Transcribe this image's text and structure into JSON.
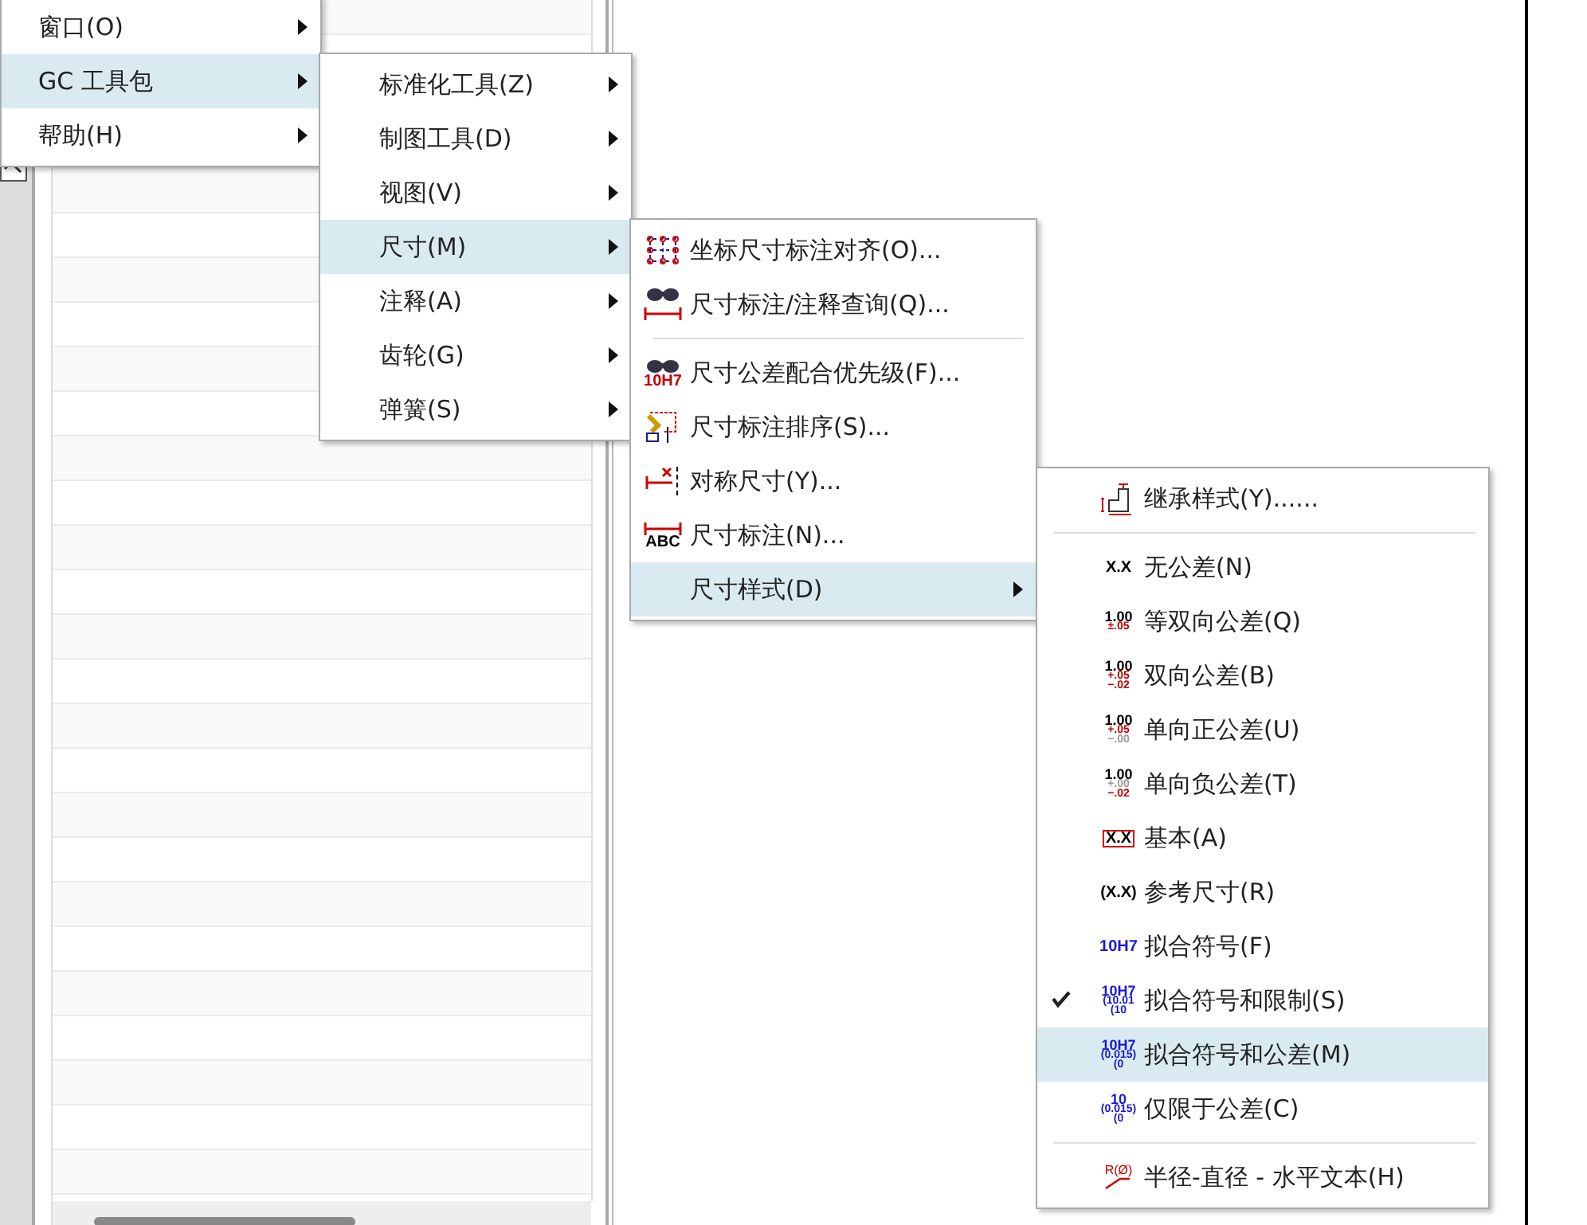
{
  "menus": [
    {
      "items": [
        {
          "kind": "submenu",
          "label": "窗口(O)",
          "selected": false
        },
        {
          "kind": "submenu",
          "label": "GC 工具包",
          "selected": true
        },
        {
          "kind": "submenu",
          "label": "帮助(H)",
          "selected": false
        }
      ]
    },
    {
      "items": [
        {
          "kind": "submenu",
          "label": "标准化工具(Z)",
          "selected": false
        },
        {
          "kind": "submenu",
          "label": "制图工具(D)",
          "selected": false
        },
        {
          "kind": "submenu",
          "label": "视图(V)",
          "selected": false
        },
        {
          "kind": "submenu",
          "label": "尺寸(M)",
          "selected": true
        },
        {
          "kind": "submenu",
          "label": "注释(A)",
          "selected": false
        },
        {
          "kind": "submenu",
          "label": "齿轮(G)",
          "selected": false
        },
        {
          "kind": "submenu",
          "label": "弹簧(S)",
          "selected": false
        }
      ]
    },
    {
      "items": [
        {
          "kind": "command",
          "label": "坐标尺寸标注对齐(O)...",
          "selected": false,
          "icon": {
            "kind": "grid"
          }
        },
        {
          "kind": "command",
          "label": "尺寸标注/注释查询(Q)...",
          "selected": false,
          "icon": {
            "kind": "binocular-dim"
          }
        },
        {
          "kind": "separator"
        },
        {
          "kind": "command",
          "label": "尺寸公差配合优先级(F)...",
          "selected": false,
          "icon": {
            "kind": "binocular-text",
            "lines": [
              {
                "text": "10H7",
                "color": "#c00000"
              }
            ]
          }
        },
        {
          "kind": "command",
          "label": "尺寸标注排序(S)...",
          "selected": false,
          "icon": {
            "kind": "sort"
          }
        },
        {
          "kind": "command",
          "label": "对称尺寸(Y)...",
          "selected": false,
          "icon": {
            "kind": "symmetric"
          }
        },
        {
          "kind": "command",
          "label": "尺寸标注(N)...",
          "selected": false,
          "icon": {
            "kind": "dim-text",
            "lines": [
              {
                "text": "ABC",
                "color": "#000000"
              }
            ]
          }
        },
        {
          "kind": "submenu",
          "label": "尺寸样式(D)",
          "selected": true
        }
      ]
    },
    {
      "items": [
        {
          "kind": "command",
          "label": "继承样式(Y)......",
          "selected": false,
          "checked": false,
          "icon": {
            "kind": "inherit"
          }
        },
        {
          "kind": "separator"
        },
        {
          "kind": "command",
          "label": "无公差(N)",
          "selected": false,
          "checked": false,
          "icon": {
            "kind": "text",
            "lines": [
              {
                "text": "X.X",
                "color": "#000000"
              }
            ]
          }
        },
        {
          "kind": "command",
          "label": "等双向公差(Q)",
          "selected": false,
          "checked": false,
          "icon": {
            "kind": "text",
            "lines": [
              {
                "text": "1.00",
                "color": "#000000"
              },
              {
                "text": "±.05",
                "color": "#c00000"
              }
            ]
          }
        },
        {
          "kind": "command",
          "label": "双向公差(B)",
          "selected": false,
          "checked": false,
          "icon": {
            "kind": "text",
            "lines": [
              {
                "text": "1.00",
                "color": "#000000"
              },
              {
                "text": "+.05",
                "color": "#c00000"
              },
              {
                "text": "−.02",
                "color": "#c00000"
              }
            ]
          }
        },
        {
          "kind": "command",
          "label": "单向正公差(U)",
          "selected": false,
          "checked": false,
          "icon": {
            "kind": "text",
            "lines": [
              {
                "text": "1.00",
                "color": "#000000"
              },
              {
                "text": "+.05",
                "color": "#c00000"
              },
              {
                "text": "−.00",
                "color": "#999999"
              }
            ]
          }
        },
        {
          "kind": "command",
          "label": "单向负公差(T)",
          "selected": false,
          "checked": false,
          "icon": {
            "kind": "text",
            "lines": [
              {
                "text": "1.00",
                "color": "#000000"
              },
              {
                "text": "+.00",
                "color": "#999999"
              },
              {
                "text": "−.02",
                "color": "#c00000"
              }
            ]
          }
        },
        {
          "kind": "command",
          "label": "基本(A)",
          "selected": false,
          "checked": false,
          "icon": {
            "kind": "boxed",
            "lines": [
              {
                "text": "X.X",
                "color": "#000000"
              }
            ]
          }
        },
        {
          "kind": "command",
          "label": "参考尺寸(R)",
          "selected": false,
          "checked": false,
          "icon": {
            "kind": "text",
            "lines": [
              {
                "text": "(X.X)",
                "color": "#000000"
              }
            ]
          }
        },
        {
          "kind": "command",
          "label": "拟合符号(F)",
          "selected": false,
          "checked": false,
          "icon": {
            "kind": "text",
            "lines": [
              {
                "text": "10H7",
                "color": "#1a1ad0"
              }
            ]
          }
        },
        {
          "kind": "command",
          "label": "拟合符号和限制(S)",
          "selected": false,
          "checked": true,
          "icon": {
            "kind": "text",
            "lines": [
              {
                "text": "10H7",
                "color": "#1a1ad0"
              },
              {
                "text": "(10.01",
                "color": "#1a1ad0"
              },
              {
                "text": "(10",
                "color": "#1a1ad0"
              }
            ]
          }
        },
        {
          "kind": "command",
          "label": "拟合符号和公差(M)",
          "selected": true,
          "checked": false,
          "icon": {
            "kind": "text",
            "lines": [
              {
                "text": "10H7",
                "color": "#1a1ad0"
              },
              {
                "text": "(0.015)",
                "color": "#1a1ad0"
              },
              {
                "text": "(0",
                "color": "#1a1ad0"
              }
            ]
          }
        },
        {
          "kind": "command",
          "label": "仅限于公差(C)",
          "selected": false,
          "checked": false,
          "icon": {
            "kind": "text",
            "lines": [
              {
                "text": "10",
                "color": "#1a1ad0"
              },
              {
                "text": "(0.015)",
                "color": "#1a1ad0"
              },
              {
                "text": "(0",
                "color": "#1a1ad0"
              }
            ]
          }
        },
        {
          "kind": "separator"
        },
        {
          "kind": "command",
          "label": "半径-直径 - 水平文本(H)",
          "selected": false,
          "checked": false,
          "icon": {
            "kind": "radius",
            "lines": [
              {
                "text": "R(Ø)",
                "color": "#c00000"
              }
            ]
          }
        }
      ]
    }
  ]
}
